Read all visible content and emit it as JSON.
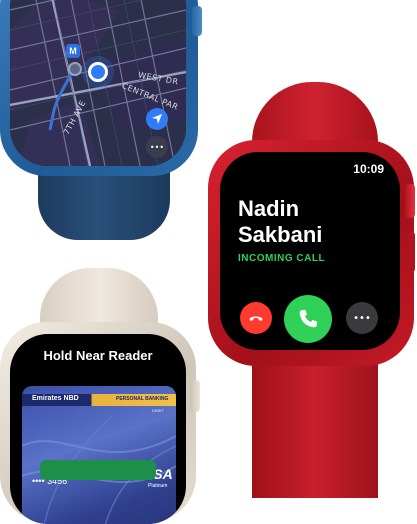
{
  "maps": {
    "streets": [
      "WEST DR",
      "CENTRAL PAR",
      "7TH AVE"
    ],
    "marker_letter": "M",
    "more_glyph": "•••"
  },
  "call": {
    "time": "10:09",
    "caller_first": "Nadin",
    "caller_last": "Sakbani",
    "status": "INCOMING CALL",
    "more_glyph": "•••"
  },
  "wallet": {
    "title": "Hold Near Reader",
    "bank_name": "Emirates NBD",
    "card_tier": "PERSONAL BANKING",
    "card_type": "DEBIT",
    "card_number": "•••• 3456",
    "network": "VISA",
    "network_tier": "Platinum"
  },
  "colors": {
    "accept_green": "#30d158",
    "decline_red": "#ff3b30",
    "incoming_green": "#2fd158",
    "location_blue": "#2f7cf6",
    "watch_blue": "#2a6aa8",
    "watch_red": "#c81f2c",
    "watch_starlight": "#e6ddd1"
  }
}
